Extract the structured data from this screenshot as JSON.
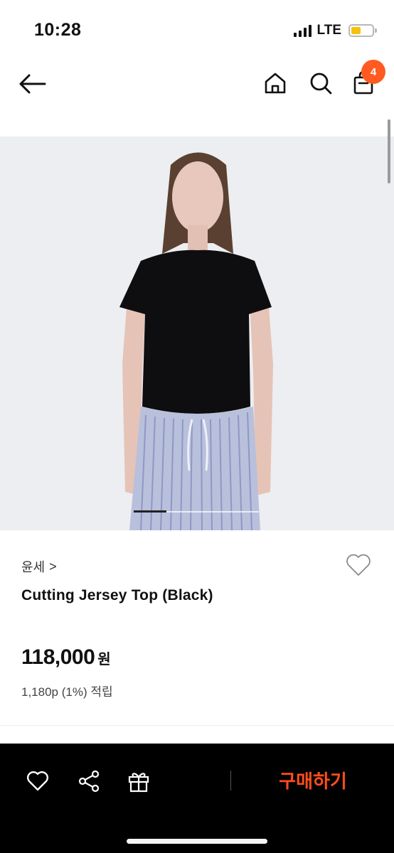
{
  "status_bar": {
    "time": "10:28",
    "network": "LTE"
  },
  "header": {
    "back_icon": "arrow-left-icon",
    "home_icon": "home-icon",
    "search_icon": "search-icon",
    "cart_icon": "shopping-bag-icon",
    "cart_count": "4"
  },
  "product": {
    "brand": "윤세",
    "brand_chevron": ">",
    "name": "Cutting Jersey Top (Black)",
    "price": "118,000",
    "currency": "원",
    "points": "1,180p (1%) 적립",
    "image_description_icon": "product-photo"
  },
  "bottom_bar": {
    "wish_icon": "heart-icon",
    "share_icon": "share-icon",
    "gift_icon": "gift-icon",
    "buy_label": "구매하기"
  },
  "colors": {
    "accent": "#ff4d1c",
    "badge": "#ff5a1f",
    "bottom_bar_bg": "#000000"
  }
}
